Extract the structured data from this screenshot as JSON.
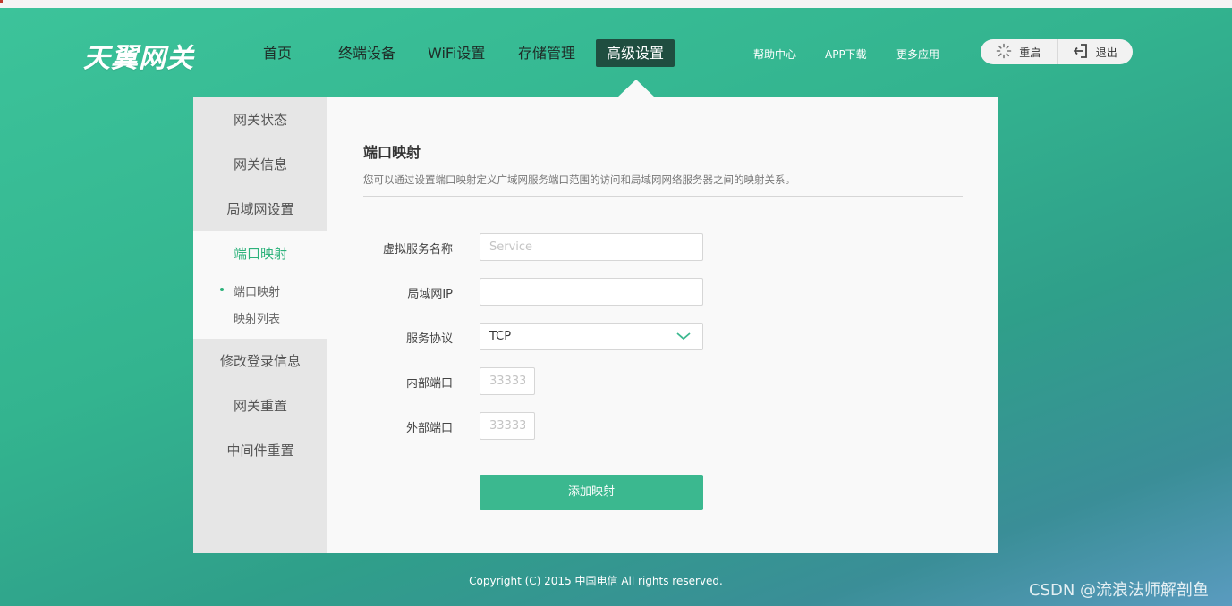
{
  "header": {
    "logo_text": "天翼网关",
    "nav": [
      {
        "label": "首页"
      },
      {
        "label": "终端设备"
      },
      {
        "label": "WiFi设置"
      },
      {
        "label": "存储管理"
      },
      {
        "label": "高级设置",
        "active": true
      }
    ],
    "links": [
      "帮助中心",
      "APP下载",
      "更多应用"
    ],
    "restart_label": "重启",
    "logout_label": "退出"
  },
  "sidebar": {
    "items": [
      "网关状态",
      "网关信息",
      "局域网设置",
      "端口映射",
      "修改登录信息",
      "网关重置",
      "中间件重置"
    ],
    "active_index": 3,
    "sub_items": [
      "端口映射",
      "映射列表"
    ]
  },
  "content": {
    "title": "端口映射",
    "description": "您可以通过设置端口映射定义广域网服务端口范围的访问和局域网网络服务器之间的映射关系。",
    "fields": {
      "service_name": {
        "label": "虚拟服务名称",
        "value": "",
        "placeholder": "Service"
      },
      "lan_ip": {
        "label": "局域网IP",
        "value": "",
        "placeholder": ""
      },
      "protocol": {
        "label": "服务协议",
        "value": "TCP"
      },
      "internal_port": {
        "label": "内部端口",
        "value": "",
        "placeholder": "33333"
      },
      "external_port": {
        "label": "外部端口",
        "value": "",
        "placeholder": "33333"
      }
    },
    "add_button": "添加映射"
  },
  "footer": {
    "copyright": "Copyright (C) 2015 中国电信 All rights reserved."
  },
  "watermark": "CSDN @流浪法师解剖鱼",
  "colors": {
    "accent": "#3bb88f",
    "nav_active_bg": "#1f4e40",
    "active_text": "#2db27b"
  }
}
